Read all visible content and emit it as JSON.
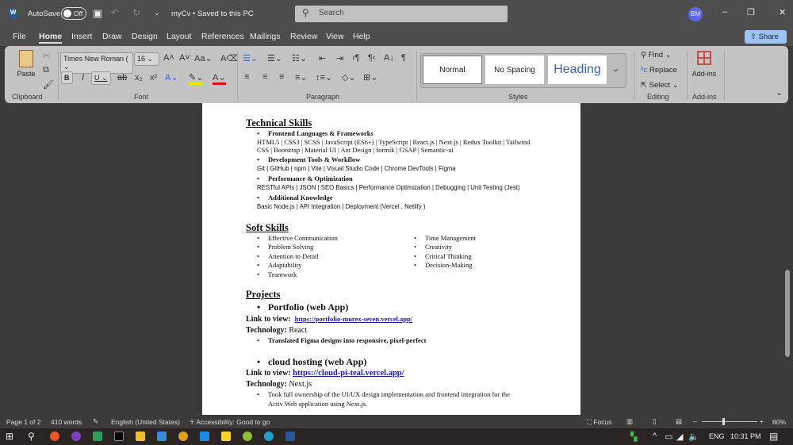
{
  "titlebar": {
    "app_icon": "word-icon",
    "autosave_label": "AutoSave",
    "autosave_state": "Off",
    "doc_title": "myCv • Saved to this PC",
    "search_placeholder": "Search",
    "avatar": "BM"
  },
  "tabs": [
    "File",
    "Home",
    "Insert",
    "Draw",
    "Design",
    "Layout",
    "References",
    "Mailings",
    "Review",
    "View",
    "Help"
  ],
  "share_label": "Share",
  "ribbon": {
    "clipboard": {
      "paste": "Paste",
      "label": "Clipboard"
    },
    "font": {
      "name": "Times New Roman (",
      "size": "16",
      "label": "Font"
    },
    "paragraph": {
      "label": "Paragraph"
    },
    "styles": {
      "items": [
        "Normal",
        "No Spacing",
        "Heading"
      ],
      "label": "Styles"
    },
    "editing": {
      "find": "Find",
      "replace": "Replace",
      "select": "Select",
      "label": "Editing"
    },
    "addins": {
      "button": "Add-ins",
      "label": "Add-ins"
    }
  },
  "doc": {
    "tech_heading": "Technical Skills",
    "tech": [
      {
        "title": "Frontend Languages & Frameworks",
        "lines": [
          "HTML5 | CSS3 | SCSS | JavaScript (ES6+) | TypeScript | React.js | Next.js | Redux Toolkit | Tailwind",
          "CSS | Bootstrap | Material UI | Ant Design | formik | GSAP | Semantic-ui"
        ]
      },
      {
        "title": "Development Tools & Workflow",
        "lines": [
          "Git | GitHub | npm | Vite | Visual Studio Code | Chrome DevTools | Figma"
        ]
      },
      {
        "title": "Performance & Optimization",
        "lines": [
          "RESTful APIs | JSON | SEO Basics | Performance Optimization | Debugging | Unit Testing (Jest)"
        ]
      },
      {
        "title": "Additional Knowledge",
        "lines": [
          "Basic Node.js | API Integration | Deployment (Vercel , Netlify )"
        ]
      }
    ],
    "soft_heading": "Soft Skills",
    "soft_left": [
      "Effective Communication",
      "Problem Solving",
      "Attention to Detail",
      "Adaptability",
      "Teamwork"
    ],
    "soft_right": [
      "Time Management",
      "Creativity",
      "Critical Thinking",
      "Decision-Making"
    ],
    "projects_heading": "Projects",
    "projects": [
      {
        "name": "Portfolio (web App)",
        "link_label": "Link to view:",
        "link": "https://portfolio-murex-seven.vercel.app/",
        "tech_label": "Technology:",
        "tech": "React",
        "bullet": "Translated Figma designs into responsive, pixel-perfect"
      },
      {
        "name": "cloud hosting (web App)",
        "link_label": "Link to view:",
        "link": "https://cloud-pi-teal.vercel.app/",
        "tech_label": "Technology:",
        "tech": "Next.js",
        "bullet": "Took full ownership of the UI/UX design implementation and frontend integration for the",
        "bullet2": "Activ Web application using Next.js."
      }
    ]
  },
  "status": {
    "page": "Page 1 of 2",
    "words": "410 words",
    "language": "English (United States)",
    "accessibility": "Accessibility: Good to go",
    "focus": "Focus",
    "zoom": "80%",
    "zoom_fraction": 0.4
  },
  "taskbar": {
    "lang": "ENG",
    "time": "10:31 PM"
  },
  "colors": {
    "word_blue": "#2b579a",
    "share": "#9cc3f5",
    "link": "#1a1aa6"
  }
}
